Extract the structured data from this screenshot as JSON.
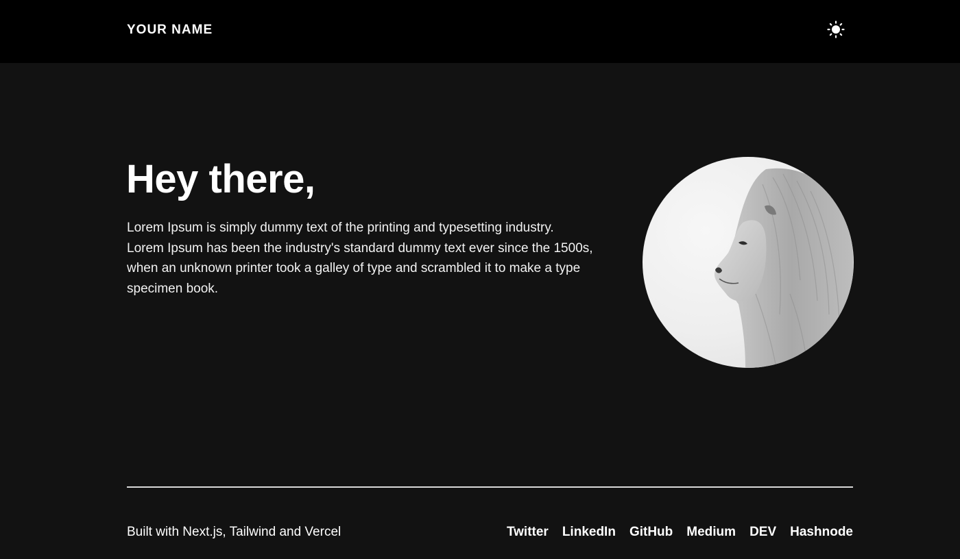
{
  "header": {
    "brand": "YOUR NAME",
    "theme_icon": "sun-icon"
  },
  "hero": {
    "title": "Hey there,",
    "body": "Lorem Ipsum is simply dummy text of the printing and typesetting industry. Lorem Ipsum has been the industry's standard dummy text ever since the 1500s, when an unknown printer took a galley of type and scrambled it to make a type specimen book.",
    "avatar_subject": "lion"
  },
  "footer": {
    "credit": "Built with Next.js, Tailwind and Vercel",
    "links": [
      {
        "label": "Twitter"
      },
      {
        "label": "LinkedIn"
      },
      {
        "label": "GitHub"
      },
      {
        "label": "Medium"
      },
      {
        "label": "DEV"
      },
      {
        "label": "Hashnode"
      }
    ]
  },
  "colors": {
    "header_bg": "#000000",
    "page_bg": "#121212",
    "text": "#ffffff",
    "divider": "#d9d9d9"
  }
}
